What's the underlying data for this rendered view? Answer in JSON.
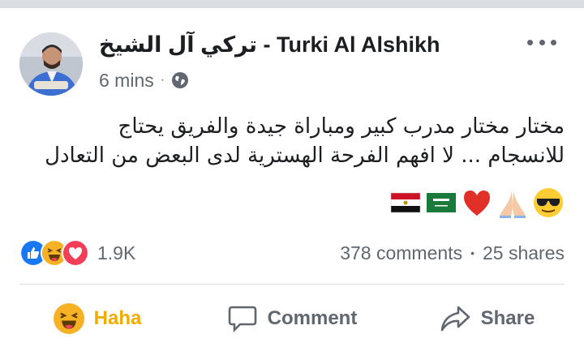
{
  "post": {
    "author": "تركي آل الشيخ - Turki Al Alshikh",
    "time": "6 mins",
    "separator": "·",
    "privacy_icon": "globe-icon",
    "text_line1": "مختار مختار مدرب كبير ومباراة جيدة والفريق يحتاج",
    "text_line2": "للانسجام ... لا افهم الفرحة الهسترية لدى البعض من التعادل",
    "emojis": [
      "sunglasses-emoji",
      "praying-hands-emoji",
      "heart-emoji",
      "saudi-flag-emoji",
      "egypt-flag-emoji"
    ]
  },
  "reactions": {
    "icons": [
      "like-icon",
      "haha-icon",
      "love-icon"
    ],
    "count": "1.9K",
    "comments": "378 comments",
    "dot": "•",
    "shares": "25 shares"
  },
  "actions": {
    "haha": "Haha",
    "comment": "Comment",
    "share": "Share"
  },
  "colors": {
    "like_blue": "#1877f2",
    "love_red": "#f33e58",
    "haha_yellow": "#f7b125",
    "active_action": "#f0ad00",
    "secondary_text": "#606770"
  }
}
